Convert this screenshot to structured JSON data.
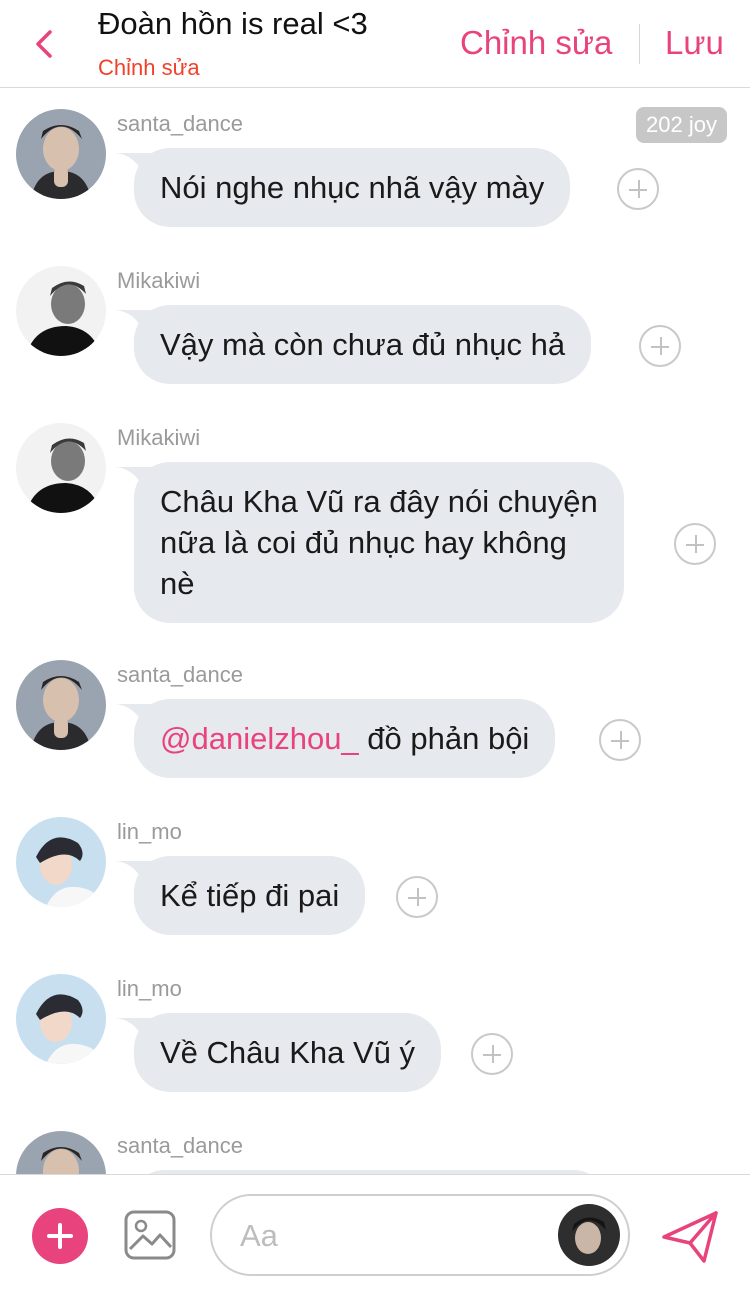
{
  "header": {
    "back_icon": "chevron-left-icon",
    "title": "Đoàn hồn is real <3",
    "subtitle": "Chỉnh sửa",
    "edit_label": "Chỉnh sửa",
    "save_label": "Lưu"
  },
  "colors": {
    "accent": "#e8437c",
    "subtitle": "#f0412a",
    "bubble": "#e6e9ed",
    "username": "#9a9a9a"
  },
  "messages": [
    {
      "username": "santa_dance",
      "text": "Nói nghe nhục nhã vậy mày",
      "badge": "202 joy"
    },
    {
      "username": "Mikakiwi",
      "text": "Vậy mà còn chưa đủ nhục hả"
    },
    {
      "username": "Mikakiwi",
      "lines": [
        "Châu Kha Vũ ra đây nói chuyện",
        "nữa là coi đủ nhục hay không",
        "nè"
      ]
    },
    {
      "username": "santa_dance",
      "mention": "@danielzhou_",
      "text": " đồ phản bội"
    },
    {
      "username": "lin_mo",
      "text": "Kể tiếp đi pai"
    },
    {
      "username": "lin_mo",
      "text": "Về Châu Kha Vũ ý"
    },
    {
      "username": "santa_dance"
    }
  ],
  "composer": {
    "placeholder": "Aa",
    "add_icon": "plus-icon",
    "image_icon": "image-icon",
    "send_icon": "send-icon"
  }
}
